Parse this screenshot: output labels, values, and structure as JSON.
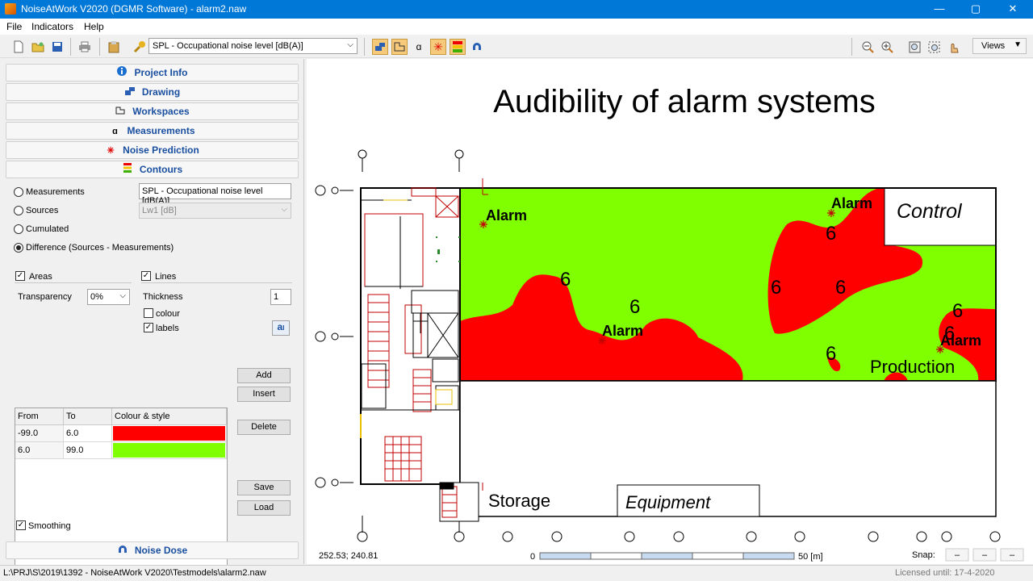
{
  "window": {
    "title": "NoiseAtWork V2020 (DGMR Software) - alarm2.naw",
    "min": "—",
    "max": "▢",
    "close": "✕"
  },
  "menu": [
    "File",
    "Indicators",
    "Help"
  ],
  "toolbar": {
    "indicator": "SPL - Occupational noise level [dB(A)]",
    "views": "Views"
  },
  "panel": {
    "sections": {
      "project_info": "Project Info",
      "drawing": "Drawing",
      "workspaces": "Workspaces",
      "measurements": "Measurements",
      "noise_prediction": "Noise Prediction",
      "contours": "Contours",
      "noise_dose": "Noise Dose"
    },
    "contours": {
      "radios": [
        "Measurements",
        "Sources",
        "Cumulated",
        "Difference (Sources - Measurements)"
      ],
      "selected_radio": 3,
      "measurements_value": "SPL - Occupational noise level [dB(A)]",
      "sources_value": "Lw1 [dB]",
      "areas_label": "Areas",
      "lines_label": "Lines",
      "transparency_label": "Transparency",
      "transparency_value": "0%",
      "thickness_label": "Thickness",
      "thickness_value": "1",
      "colour_label": "colour",
      "labels_label": "labels",
      "table": {
        "headers": [
          "From",
          "To",
          "Colour & style"
        ],
        "rows": [
          {
            "from": "-99.0",
            "to": "6.0",
            "color": "#ff0000"
          },
          {
            "from": "6.0",
            "to": "99.0",
            "color": "#80ff00"
          }
        ]
      },
      "buttons": {
        "add": "Add",
        "insert": "Insert",
        "delete": "Delete",
        "save": "Save",
        "load": "Load"
      },
      "smoothing_label": "Smoothing"
    }
  },
  "drawing": {
    "title": "Audibility of alarm systems",
    "labels": {
      "alarm": "Alarm",
      "control": "Control",
      "production": "Production",
      "storage": "Storage",
      "equipment": "Equipment",
      "contour_value": "6"
    },
    "colors": {
      "red": "#ff0000",
      "green": "#80ff00"
    },
    "coords": "252.53; 240.81",
    "scale": {
      "start": "0",
      "end": "50 [m]"
    },
    "snap": {
      "label": "Snap:",
      "values": [
        "–",
        "–",
        "–"
      ]
    }
  },
  "status": {
    "path": "L:\\PRJ\\S\\2019\\1392 - NoiseAtWork V2020\\Testmodels\\alarm2.naw",
    "license": "Licensed until: 17-4-2020"
  }
}
